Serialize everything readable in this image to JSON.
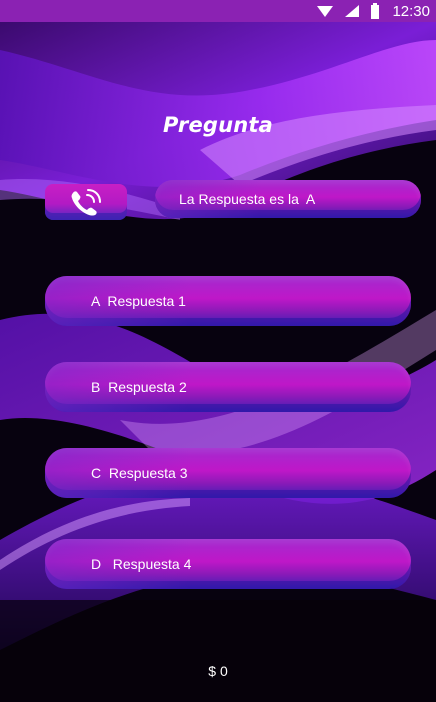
{
  "status_bar": {
    "time": "12:30",
    "icons": [
      "wifi-icon",
      "signal-icon",
      "battery-icon"
    ]
  },
  "title": "Pregunta",
  "lifeline": {
    "icon": "phone-call-icon"
  },
  "hint": {
    "text": "La Respuesta es la  A"
  },
  "answers": [
    {
      "label": "A  Respuesta 1"
    },
    {
      "label": "B  Respuesta 2"
    },
    {
      "label": "C  Respuesta 3"
    },
    {
      "label": "D   Respuesta 4"
    }
  ],
  "score": {
    "text": "$ 0"
  },
  "colors": {
    "status_bar": "#8b22b3",
    "accent": "#c81fc5",
    "background": "#07020f"
  }
}
